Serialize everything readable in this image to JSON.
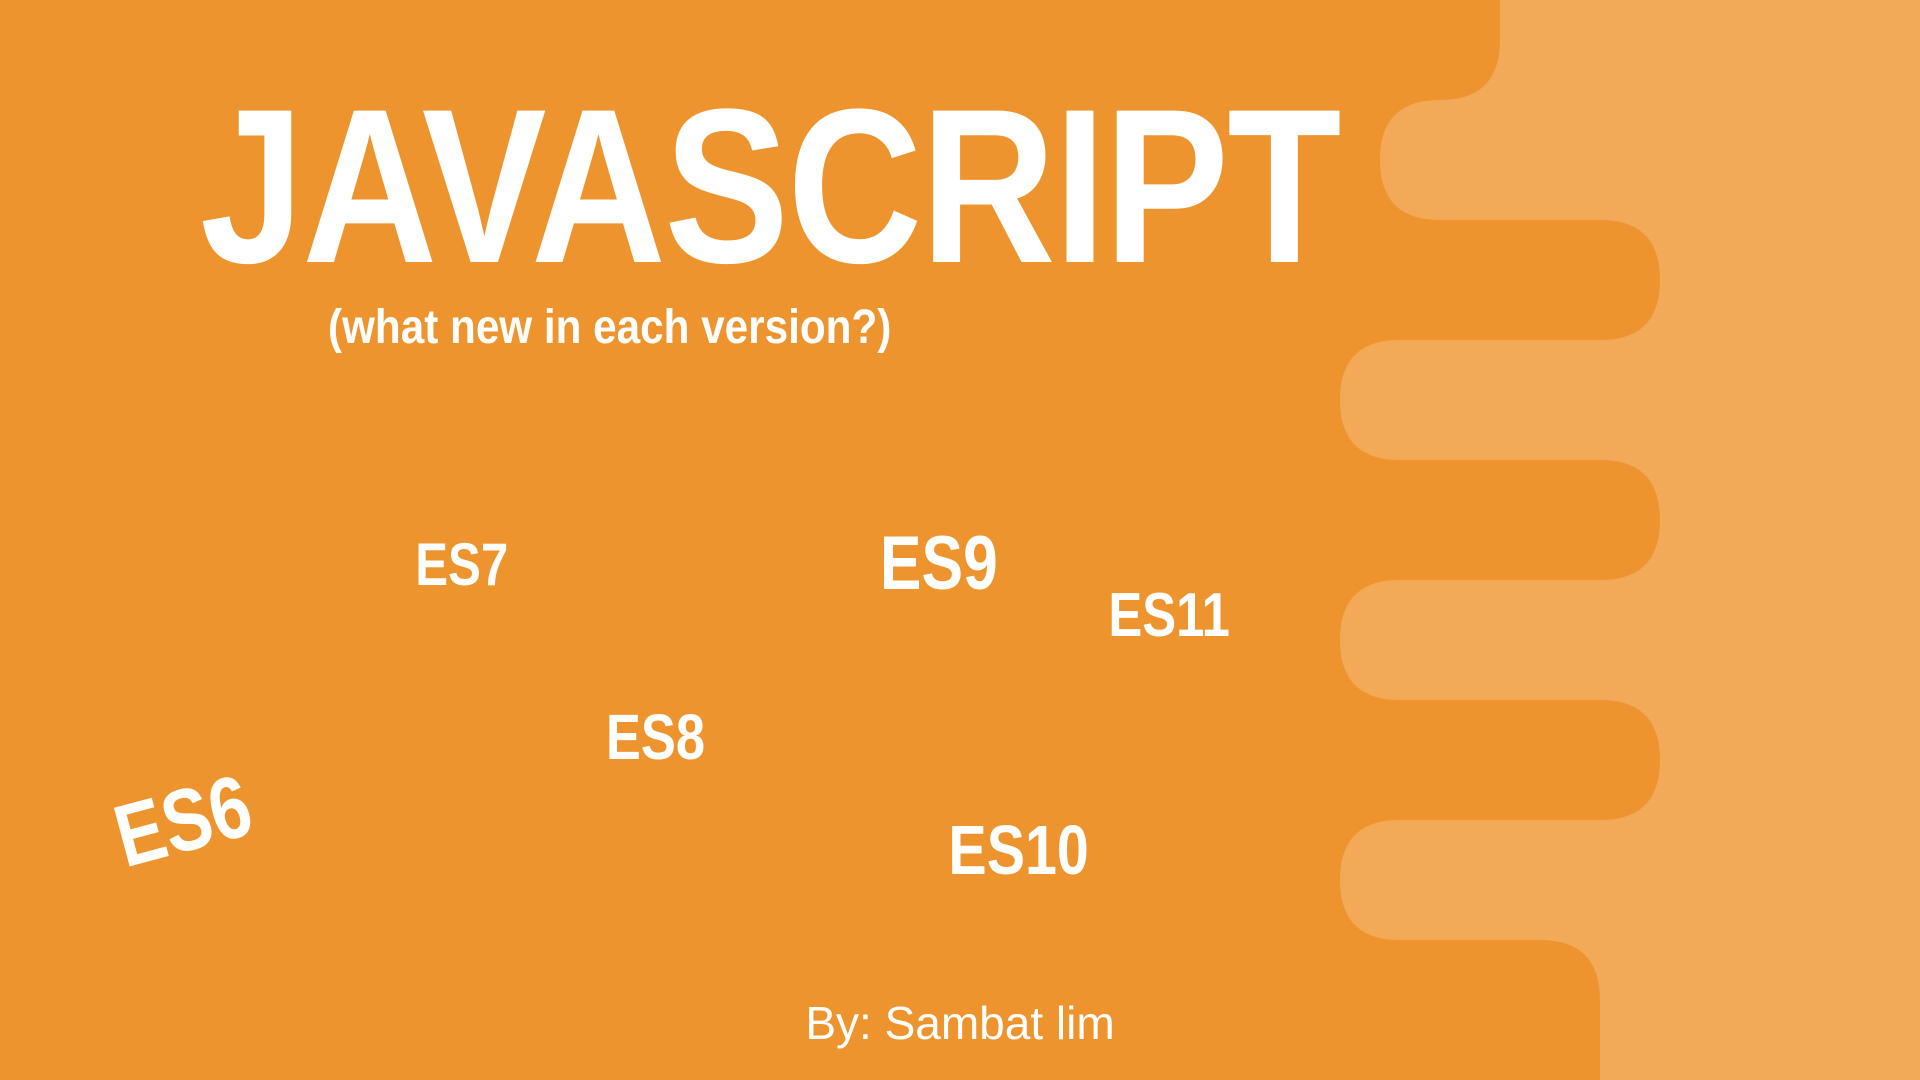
{
  "title": "JAVASCRIPT",
  "subtitle": "(what new in each version?)",
  "versions": {
    "es6": "ES6",
    "es7": "ES7",
    "es8": "ES8",
    "es9": "ES9",
    "es10": "ES10",
    "es11": "ES11"
  },
  "author": "By: Sambat lim",
  "colors": {
    "background": "#ee942e",
    "wave": "#f3aa58",
    "text": "#ffffff"
  }
}
